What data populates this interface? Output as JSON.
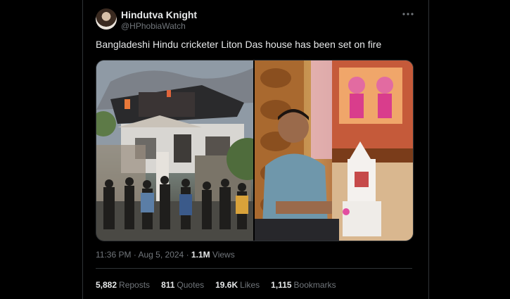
{
  "author": {
    "display_name": "Hindutva Knight",
    "handle": "@HPhobiaWatch"
  },
  "more_icon": "more-horizontal-icon",
  "tweet": {
    "text": "Bangladeshi Hindu cricketer Liton Das house has been set on fire"
  },
  "meta": {
    "time": "11:36 PM",
    "dot1": " · ",
    "date": "Aug 5, 2024",
    "dot2": " · ",
    "views_count": "1.1M",
    "views_label": " Views"
  },
  "stats": [
    {
      "count": "5,882",
      "label": "Reposts"
    },
    {
      "count": "811",
      "label": "Quotes"
    },
    {
      "count": "19.6K",
      "label": "Likes"
    },
    {
      "count": "1,115",
      "label": "Bookmarks"
    }
  ],
  "colors": {
    "background": "#000000",
    "text_primary": "#e7e9ea",
    "text_secondary": "#71767b",
    "border": "#2f3336"
  }
}
